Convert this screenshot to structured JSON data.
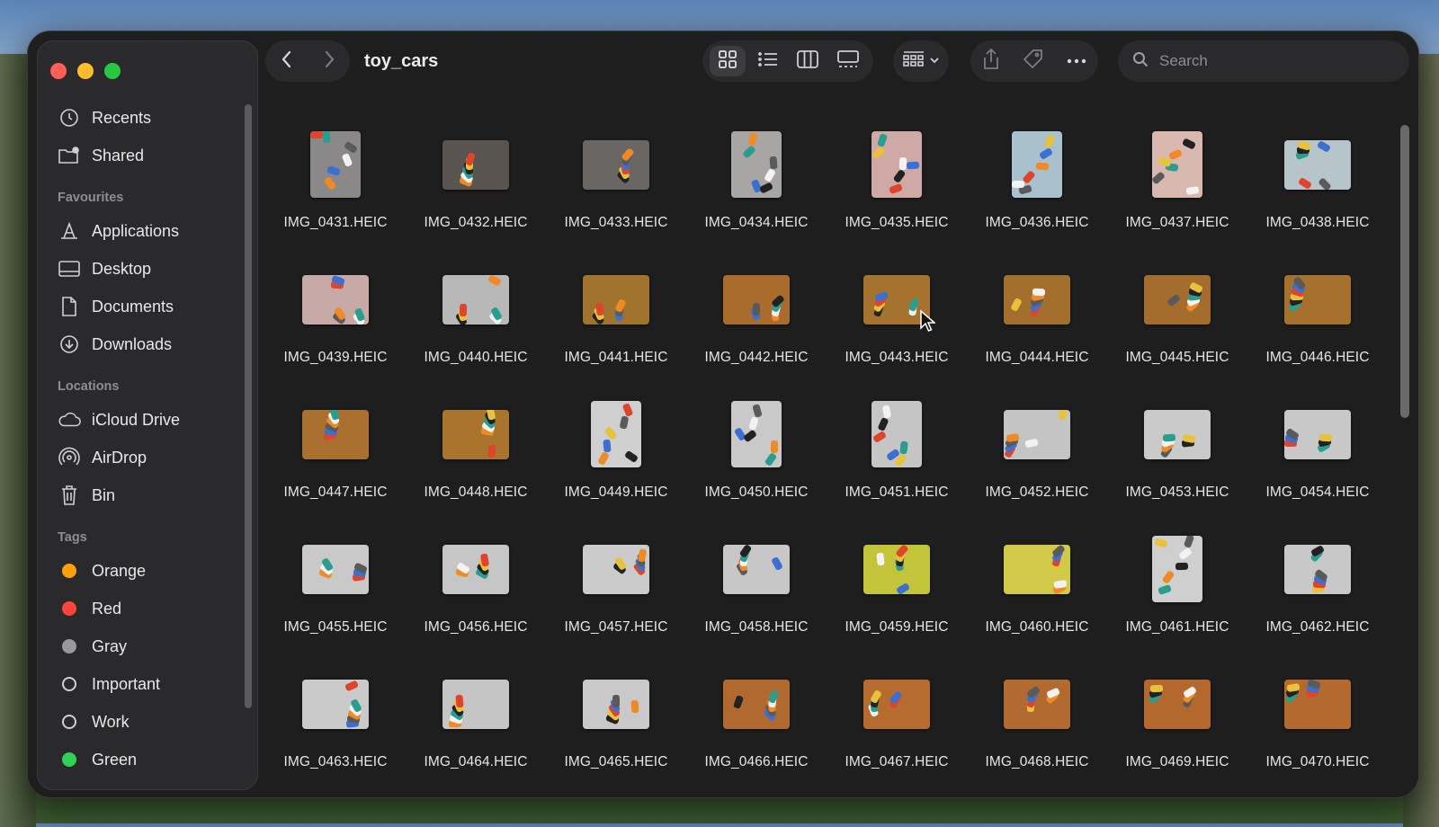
{
  "window": {
    "folder_title": "toy_cars",
    "search_placeholder": "Search"
  },
  "sidebar": {
    "top_items": [
      {
        "label": "Recents",
        "icon": "clock-icon"
      },
      {
        "label": "Shared",
        "icon": "shared-folder-icon"
      }
    ],
    "favourites_header": "Favourites",
    "favourites": [
      {
        "label": "Applications",
        "icon": "applications-icon"
      },
      {
        "label": "Desktop",
        "icon": "desktop-icon"
      },
      {
        "label": "Documents",
        "icon": "document-icon"
      },
      {
        "label": "Downloads",
        "icon": "download-icon"
      }
    ],
    "locations_header": "Locations",
    "locations": [
      {
        "label": "iCloud Drive",
        "icon": "cloud-icon"
      },
      {
        "label": "AirDrop",
        "icon": "airdrop-icon"
      },
      {
        "label": "Bin",
        "icon": "trash-icon"
      }
    ],
    "tags_header": "Tags",
    "tags": [
      {
        "label": "Orange",
        "color": "#ff9f0a"
      },
      {
        "label": "Red",
        "color": "#ff453a"
      },
      {
        "label": "Gray",
        "color": "#98989d"
      },
      {
        "label": "Important",
        "color": ""
      },
      {
        "label": "Work",
        "color": ""
      },
      {
        "label": "Green",
        "color": "#30d158"
      }
    ]
  },
  "toolbar": {
    "icons": [
      "back-icon",
      "forward-icon",
      "icon-view-icon",
      "list-view-icon",
      "column-view-icon",
      "gallery-view-icon",
      "group-icon",
      "share-icon",
      "tag-icon",
      "more-icon",
      "search-icon"
    ]
  },
  "files": [
    {
      "name": "IMG_0431.HEIC",
      "orient": "port",
      "bg": "#8a8888"
    },
    {
      "name": "IMG_0432.HEIC",
      "orient": "land",
      "bg": "#5a5450"
    },
    {
      "name": "IMG_0433.HEIC",
      "orient": "land",
      "bg": "#6a6664"
    },
    {
      "name": "IMG_0434.HEIC",
      "orient": "port",
      "bg": "#a8a6a4"
    },
    {
      "name": "IMG_0435.HEIC",
      "orient": "port",
      "bg": "#cfa9a6"
    },
    {
      "name": "IMG_0436.HEIC",
      "orient": "port",
      "bg": "#a9c1cc"
    },
    {
      "name": "IMG_0437.HEIC",
      "orient": "port",
      "bg": "#d9b8b0"
    },
    {
      "name": "IMG_0438.HEIC",
      "orient": "land",
      "bg": "#b7c4c9"
    },
    {
      "name": "IMG_0439.HEIC",
      "orient": "land",
      "bg": "#c7a9a5"
    },
    {
      "name": "IMG_0440.HEIC",
      "orient": "land",
      "bg": "#b8b8b8"
    },
    {
      "name": "IMG_0441.HEIC",
      "orient": "land",
      "bg": "#a0742c"
    },
    {
      "name": "IMG_0442.HEIC",
      "orient": "land",
      "bg": "#a96c2c"
    },
    {
      "name": "IMG_0443.HEIC",
      "orient": "land",
      "bg": "#a6732e"
    },
    {
      "name": "IMG_0444.HEIC",
      "orient": "land",
      "bg": "#a26f2c"
    },
    {
      "name": "IMG_0445.HEIC",
      "orient": "land",
      "bg": "#a56d2d"
    },
    {
      "name": "IMG_0446.HEIC",
      "orient": "land",
      "bg": "#a5712d"
    },
    {
      "name": "IMG_0447.HEIC",
      "orient": "land",
      "bg": "#a9702f"
    },
    {
      "name": "IMG_0448.HEIC",
      "orient": "land",
      "bg": "#a8742e"
    },
    {
      "name": "IMG_0449.HEIC",
      "orient": "port",
      "bg": "#cfcfcf"
    },
    {
      "name": "IMG_0450.HEIC",
      "orient": "port",
      "bg": "#c9c9c9"
    },
    {
      "name": "IMG_0451.HEIC",
      "orient": "port",
      "bg": "#c5c5c5"
    },
    {
      "name": "IMG_0452.HEIC",
      "orient": "land",
      "bg": "#c4c4c4"
    },
    {
      "name": "IMG_0453.HEIC",
      "orient": "land",
      "bg": "#cacaca"
    },
    {
      "name": "IMG_0454.HEIC",
      "orient": "land",
      "bg": "#c8c8c8"
    },
    {
      "name": "IMG_0455.HEIC",
      "orient": "land",
      "bg": "#c9c9c9"
    },
    {
      "name": "IMG_0456.HEIC",
      "orient": "land",
      "bg": "#c6c6c6"
    },
    {
      "name": "IMG_0457.HEIC",
      "orient": "land",
      "bg": "#cbcbcb"
    },
    {
      "name": "IMG_0458.HEIC",
      "orient": "land",
      "bg": "#c7c7c7"
    },
    {
      "name": "IMG_0459.HEIC",
      "orient": "land",
      "bg": "#c4c43a"
    },
    {
      "name": "IMG_0460.HEIC",
      "orient": "land",
      "bg": "#d1c94a"
    },
    {
      "name": "IMG_0461.HEIC",
      "orient": "port",
      "bg": "#cfcfcf"
    },
    {
      "name": "IMG_0462.HEIC",
      "orient": "land",
      "bg": "#c8c8c8"
    },
    {
      "name": "IMG_0463.HEIC",
      "orient": "land",
      "bg": "#cacaca"
    },
    {
      "name": "IMG_0464.HEIC",
      "orient": "land",
      "bg": "#c5c5c5"
    },
    {
      "name": "IMG_0465.HEIC",
      "orient": "land",
      "bg": "#c9c9c9"
    },
    {
      "name": "IMG_0466.HEIC",
      "orient": "land",
      "bg": "#b06a30"
    },
    {
      "name": "IMG_0467.HEIC",
      "orient": "land",
      "bg": "#b56c2e"
    },
    {
      "name": "IMG_0468.HEIC",
      "orient": "land",
      "bg": "#b16a30"
    },
    {
      "name": "IMG_0469.HEIC",
      "orient": "land",
      "bg": "#b5682e"
    },
    {
      "name": "IMG_0470.HEIC",
      "orient": "land",
      "bg": "#b4692f"
    }
  ]
}
